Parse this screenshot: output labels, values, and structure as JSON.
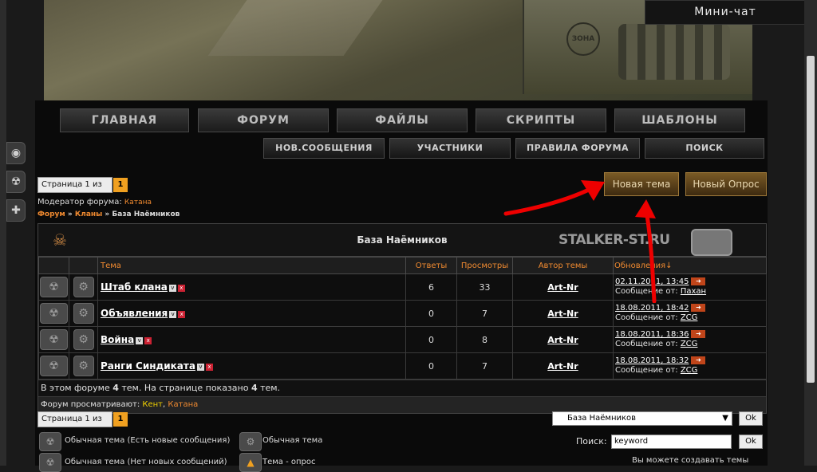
{
  "sidebar": {
    "icons": [
      "eye-icon",
      "radiation-icon",
      "plus-icon"
    ]
  },
  "banner": {
    "badge": "ЗОНА"
  },
  "minichat": "Мини-чат",
  "nav": {
    "main": [
      "ГЛАВНАЯ",
      "ФОРУМ",
      "ФАЙЛЫ",
      "СКРИПТЫ",
      "ШАБЛОНЫ"
    ],
    "secondary": [
      "НОВ.СООБЩЕНИЯ",
      "УЧАСТНИКИ",
      "ПРАВИЛА ФОРУМА",
      "ПОИСК"
    ]
  },
  "pagination": {
    "label": "Страница 1 из 1",
    "current": "1"
  },
  "actions": {
    "new_topic": "Новая тема",
    "new_poll": "Новый Опрос"
  },
  "moderator": {
    "label": "Модератор форума:",
    "name": "Катана"
  },
  "breadcrumb": {
    "a": "Форум",
    "sep": "»",
    "b": "Кланы",
    "c": "База Наёмников"
  },
  "forum": {
    "title": "База Наёмников",
    "logo": "STALKER-ST.RU",
    "columns": [
      "Тема",
      "Ответы",
      "Просмотры",
      "Автор темы",
      "Обновления↓"
    ],
    "rows": [
      {
        "topic": "Штаб клана",
        "replies": "6",
        "views": "33",
        "author": "Art-Nr",
        "date": "02.11.2011, 13:45",
        "by": "Сообщение от:",
        "user": "Пахан"
      },
      {
        "topic": "Объявления",
        "replies": "0",
        "views": "7",
        "author": "Art-Nr",
        "date": "18.08.2011, 18:42",
        "by": "Сообщение от:",
        "user": "ZCG"
      },
      {
        "topic": "Война",
        "replies": "0",
        "views": "8",
        "author": "Art-Nr",
        "date": "18.08.2011, 18:36",
        "by": "Сообщение от:",
        "user": "ZCG"
      },
      {
        "topic": "Ранги Синдиката",
        "replies": "0",
        "views": "7",
        "author": "Art-Nr",
        "date": "18.08.2011, 18:32",
        "by": "Сообщение от:",
        "user": "ZCG"
      }
    ],
    "summary_a": "В этом форуме",
    "summary_n1": "4",
    "summary_b": "тем. На странице показано",
    "summary_n2": "4",
    "summary_c": "тем.",
    "viewing_label": "Форум просматривают:",
    "viewer1": "Кент",
    "viewer_sep": ",",
    "viewer2": "Катана"
  },
  "legend": {
    "a": "Обычная тема (Есть новые сообщения)",
    "b": "Обычная тема",
    "c": "Обычная тема (Нет новых сообщений)",
    "d": "Тема - опрос"
  },
  "jump": {
    "selected": "База Наёмников",
    "ok": "Ok"
  },
  "search": {
    "label": "Поиск:",
    "value": "keyword",
    "ok": "Ok"
  },
  "bottom_text": "Вы можете создавать темы"
}
